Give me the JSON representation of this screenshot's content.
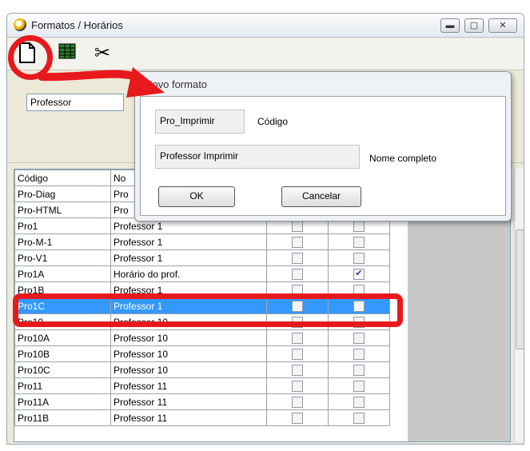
{
  "window": {
    "title": "Formatos / Horários",
    "buttons": [
      "minimize-icon",
      "maximize-icon",
      "close-icon"
    ]
  },
  "toolbar": {
    "icons": [
      "new-document-icon",
      "table-icon",
      "scissors-icon"
    ]
  },
  "combo": {
    "value": "Professor"
  },
  "table": {
    "headers": [
      "Código",
      "No"
    ],
    "rows": [
      {
        "code": "Pro-Diag",
        "name": "Pro"
      },
      {
        "code": "Pro-HTML",
        "name": "Pro"
      },
      {
        "code": "Pro1",
        "name": "Professor 1",
        "c1": false,
        "c2": false
      },
      {
        "code": "Pro-M-1",
        "name": "Professor 1",
        "c1": false,
        "c2": false
      },
      {
        "code": "Pro-V1",
        "name": "Professor 1",
        "c1": false,
        "c2": false
      },
      {
        "code": "Pro1A",
        "name": "Horário do prof.",
        "c1": false,
        "c2": true
      },
      {
        "code": "Pro1B",
        "name": "Professor 1",
        "c1": false,
        "c2": false
      },
      {
        "code": "Pro1C",
        "name": "Professor 1",
        "c1": false,
        "c2": false,
        "selected": true
      },
      {
        "code": "Pro10",
        "name": "Professor 10",
        "c1": false,
        "c2": false
      },
      {
        "code": "Pro10A",
        "name": "Professor 10",
        "c1": false,
        "c2": false
      },
      {
        "code": "Pro10B",
        "name": "Professor 10",
        "c1": false,
        "c2": false
      },
      {
        "code": "Pro10C",
        "name": "Professor 10",
        "c1": false,
        "c2": false
      },
      {
        "code": "Pro11",
        "name": "Professor 11",
        "c1": false,
        "c2": false
      },
      {
        "code": "Pro11A",
        "name": "Professor 11",
        "c1": false,
        "c2": false
      },
      {
        "code": "Pro11B",
        "name": "Professor 11",
        "c1": false,
        "c2": false
      }
    ]
  },
  "dialog": {
    "title": "Novo formato",
    "code_value": "Pro_Imprimir",
    "code_label": "Código",
    "name_value": "Professor Imprimir",
    "name_label": "Nome completo",
    "ok_label": "OK",
    "cancel_label": "Cancelar"
  },
  "colors": {
    "highlight": "#e8191c",
    "selection": "#3399ff"
  }
}
